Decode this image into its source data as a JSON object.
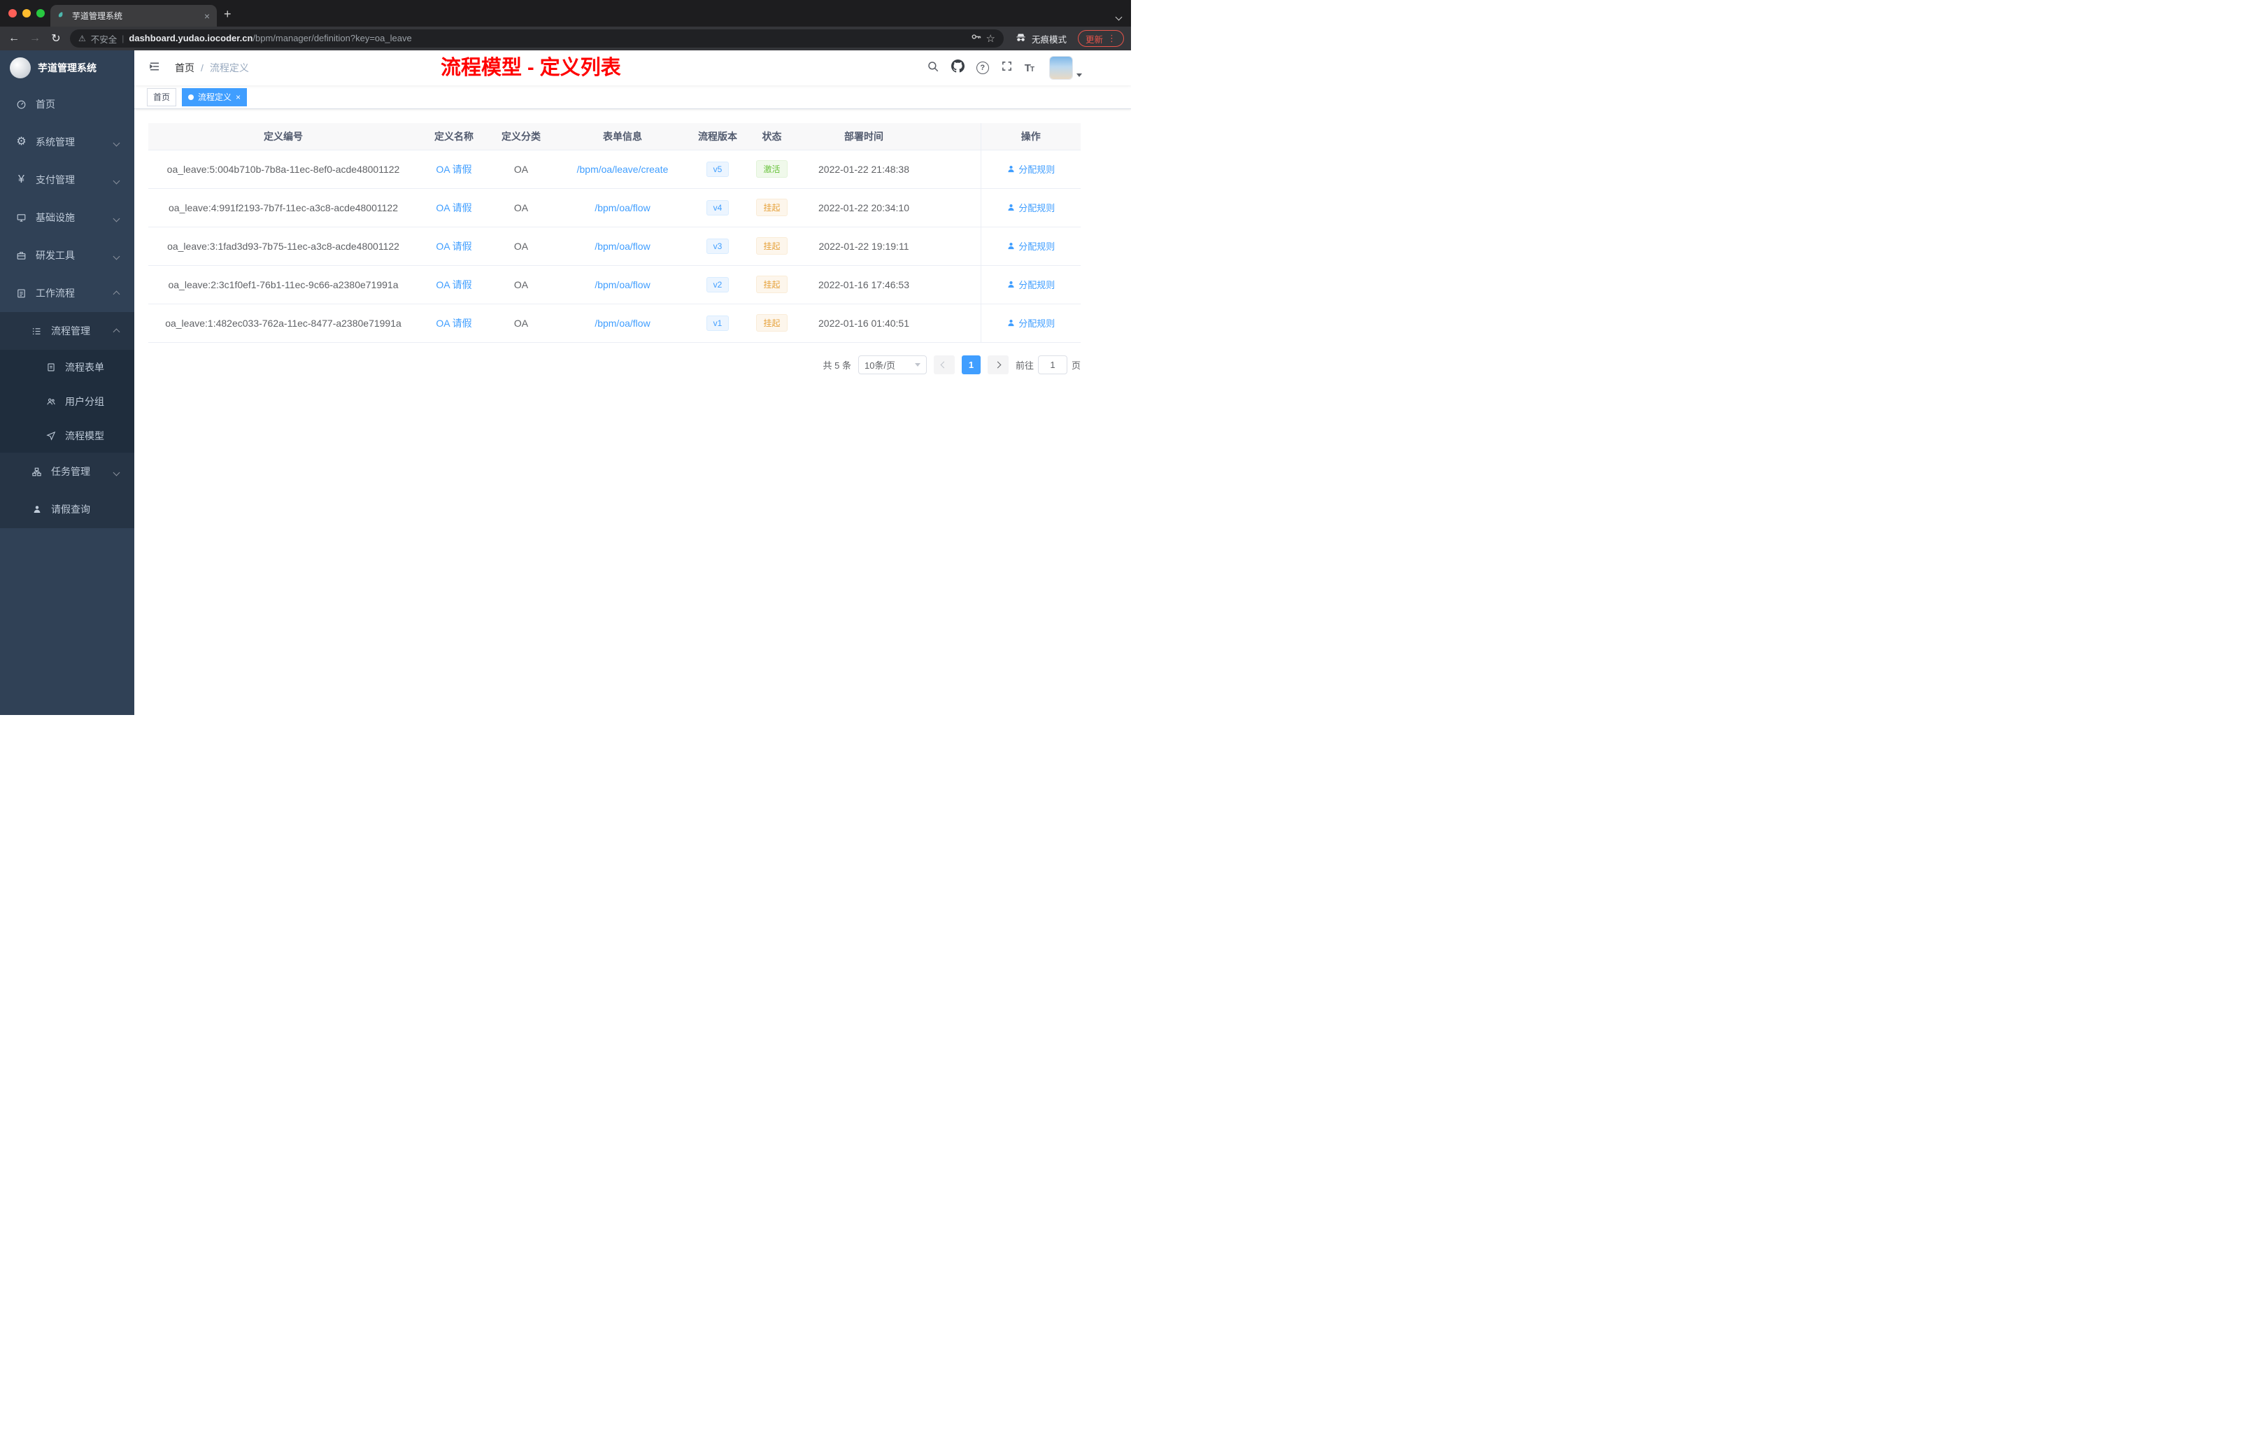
{
  "browser": {
    "tab_title": "芋道管理系统",
    "address": {
      "security_label": "不安全",
      "separator": "|",
      "domain": "dashboard.yudao.iocoder.cn",
      "path": "/bpm/manager/definition?key=oa_leave"
    },
    "incognito_label": "无痕模式",
    "update_label": "更新"
  },
  "sidebar": {
    "logo_title": "芋道管理系统",
    "items": [
      {
        "label": "首页",
        "icon": "dashboard-icon"
      },
      {
        "label": "系统管理",
        "icon": "gear-icon"
      },
      {
        "label": "支付管理",
        "icon": "yen-icon"
      },
      {
        "label": "基础设施",
        "icon": "infrastructure-icon"
      },
      {
        "label": "研发工具",
        "icon": "dev-tools-icon"
      },
      {
        "label": "工作流程",
        "icon": "workflow-icon"
      },
      {
        "label": "流程管理",
        "icon": "process-list-icon"
      },
      {
        "label": "流程表单",
        "icon": "form-icon"
      },
      {
        "label": "用户分组",
        "icon": "user-group-icon"
      },
      {
        "label": "流程模型",
        "icon": "paper-plane-icon"
      },
      {
        "label": "任务管理",
        "icon": "task-icon"
      },
      {
        "label": "请假查询",
        "icon": "person-icon"
      }
    ]
  },
  "navbar": {
    "breadcrumb": {
      "home": "首页",
      "separator": "/",
      "current": "流程定义"
    },
    "annotation": "流程模型 - 定义列表"
  },
  "tags": {
    "items": [
      {
        "label": "首页"
      },
      {
        "label": "流程定义"
      }
    ]
  },
  "table": {
    "columns": [
      "定义编号",
      "定义名称",
      "定义分类",
      "表单信息",
      "流程版本",
      "状态",
      "部署时间",
      "操作"
    ],
    "action_label": "分配规则",
    "rows": [
      {
        "id": "oa_leave:5:004b710b-7b8a-11ec-8ef0-acde48001122",
        "name": "OA 请假",
        "category": "OA",
        "form": "/bpm/oa/leave/create",
        "version": "v5",
        "status": "激活",
        "time": "2022-01-22 21:48:38"
      },
      {
        "id": "oa_leave:4:991f2193-7b7f-11ec-a3c8-acde48001122",
        "name": "OA 请假",
        "category": "OA",
        "form": "/bpm/oa/flow",
        "version": "v4",
        "status": "挂起",
        "time": "2022-01-22 20:34:10"
      },
      {
        "id": "oa_leave:3:1fad3d93-7b75-11ec-a3c8-acde48001122",
        "name": "OA 请假",
        "category": "OA",
        "form": "/bpm/oa/flow",
        "version": "v3",
        "status": "挂起",
        "time": "2022-01-22 19:19:11"
      },
      {
        "id": "oa_leave:2:3c1f0ef1-76b1-11ec-9c66-a2380e71991a",
        "name": "OA 请假",
        "category": "OA",
        "form": "/bpm/oa/flow",
        "version": "v2",
        "status": "挂起",
        "time": "2022-01-16 17:46:53"
      },
      {
        "id": "oa_leave:1:482ec033-762a-11ec-8477-a2380e71991a",
        "name": "OA 请假",
        "category": "OA",
        "form": "/bpm/oa/flow",
        "version": "v1",
        "status": "挂起",
        "time": "2022-01-16 01:40:51"
      }
    ]
  },
  "pagination": {
    "total": "共 5 条",
    "page_size": "10条/页",
    "current_page": "1",
    "goto_label": "前往",
    "goto_value": "1",
    "unit_label": "页"
  }
}
